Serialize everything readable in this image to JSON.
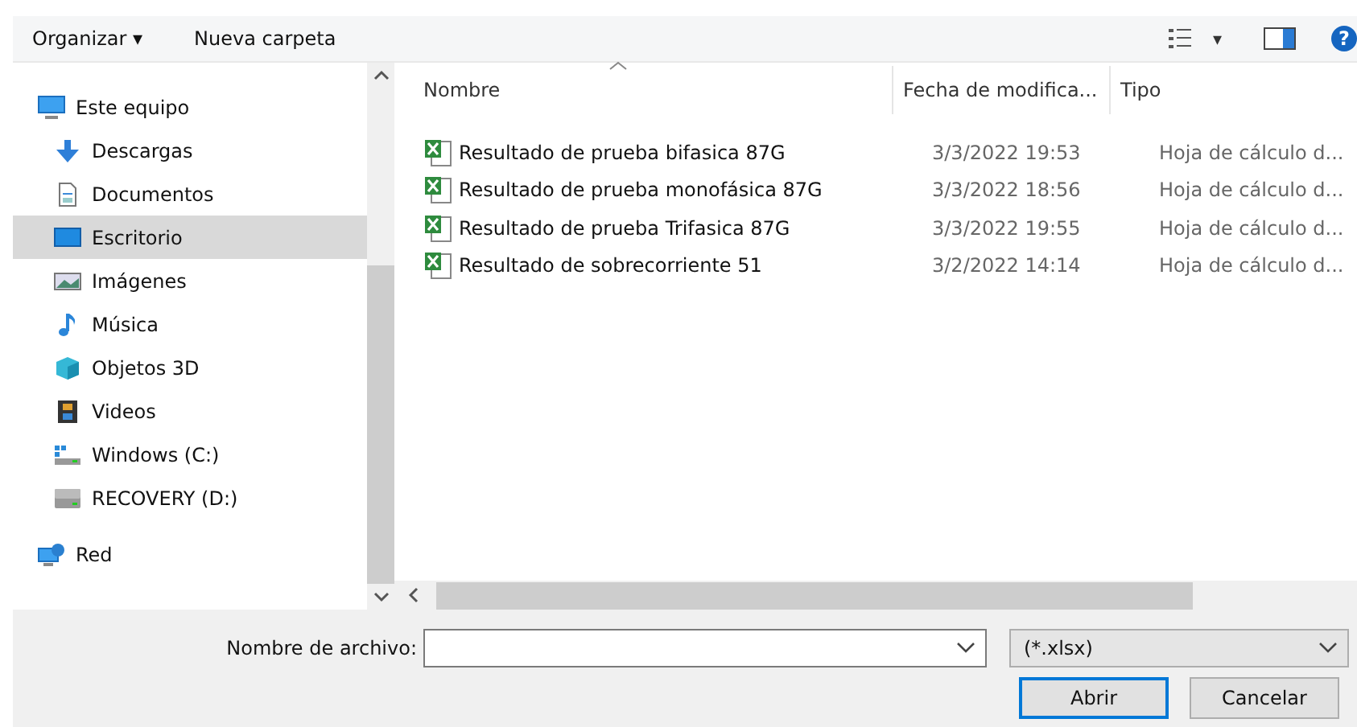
{
  "toolbar": {
    "organize": "Organizar ▾",
    "new_folder": "Nueva carpeta",
    "view_caret": "▾",
    "help": "?"
  },
  "sidebar": {
    "items": [
      {
        "label": "Este equipo",
        "kind": "computer",
        "selected": false,
        "children": [
          {
            "label": "Descargas",
            "kind": "download",
            "selected": false
          },
          {
            "label": "Documentos",
            "kind": "document",
            "selected": false
          },
          {
            "label": "Escritorio",
            "kind": "desktop",
            "selected": true
          },
          {
            "label": "Imágenes",
            "kind": "image",
            "selected": false
          },
          {
            "label": "Música",
            "kind": "music",
            "selected": false
          },
          {
            "label": "Objetos 3D",
            "kind": "cube",
            "selected": false
          },
          {
            "label": "Videos",
            "kind": "film",
            "selected": false
          },
          {
            "label": "Windows (C:)",
            "kind": "drive-win",
            "selected": false
          },
          {
            "label": "RECOVERY (D:)",
            "kind": "drive",
            "selected": false
          }
        ]
      },
      {
        "label": "Red",
        "kind": "network",
        "selected": false
      }
    ]
  },
  "table": {
    "columns": [
      "Nombre",
      "Fecha de modifica...",
      "Tipo"
    ],
    "rows": [
      {
        "name": "Resultado de prueba bifasica 87G",
        "date": "3/3/2022 19:53",
        "type": "Hoja de cálculo d..."
      },
      {
        "name": "Resultado de prueba monofásica 87G",
        "date": "3/3/2022 18:56",
        "type": "Hoja de cálculo d..."
      },
      {
        "name": "Resultado de prueba Trifasica 87G",
        "date": "3/3/2022 19:55",
        "type": "Hoja de cálculo d..."
      },
      {
        "name": "Resultado de sobrecorriente 51",
        "date": "3/2/2022 14:14",
        "type": "Hoja de cálculo d..."
      }
    ]
  },
  "footer": {
    "filename_label": "Nombre de archivo:",
    "filter": "(*.xlsx)",
    "open": "Abrir",
    "cancel": "Cancelar"
  }
}
